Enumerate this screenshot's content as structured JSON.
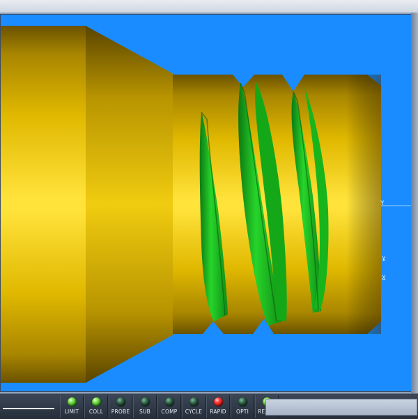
{
  "viewport": {
    "colors": {
      "background": "#1a8cff",
      "workpiece": "#f2cc00",
      "thread_cut": "#1fc41f"
    },
    "axis_labels": [
      "Y",
      "Y",
      "X"
    ]
  },
  "status_indicators": [
    {
      "label": "LIMIT",
      "state": "on",
      "color": "green"
    },
    {
      "label": "COLL",
      "state": "on",
      "color": "green"
    },
    {
      "label": "PROBE",
      "state": "off",
      "color": "dark"
    },
    {
      "label": "SUB",
      "state": "off",
      "color": "dark"
    },
    {
      "label": "COMP",
      "state": "off",
      "color": "dark"
    },
    {
      "label": "CYCLE",
      "state": "off",
      "color": "dark"
    },
    {
      "label": "RAPID",
      "state": "on",
      "color": "red"
    },
    {
      "label": "OPTI",
      "state": "off",
      "color": "dark"
    },
    {
      "label": "READY",
      "state": "on",
      "color": "green"
    }
  ]
}
